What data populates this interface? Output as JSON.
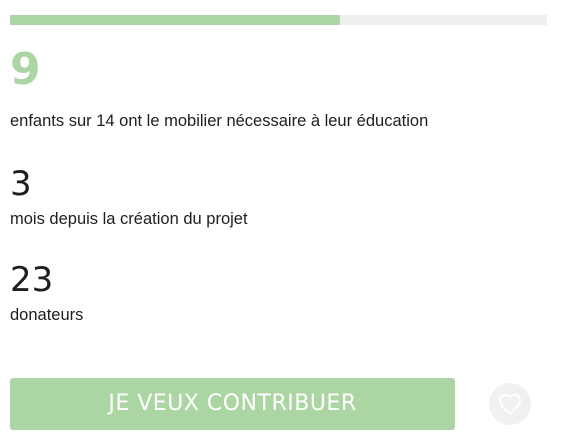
{
  "progress": {
    "fraction": 0.614,
    "fill_color": "#acd5a4",
    "track_color": "#efefef"
  },
  "highlight": {
    "number": "9",
    "caption": "enfants sur 14 ont le mobilier nécessaire à leur éducation",
    "color": "#acd5a4"
  },
  "stats": {
    "months": {
      "number": "3",
      "caption": "mois depuis la création du projet"
    },
    "donors": {
      "number": "23",
      "caption": "donateurs"
    }
  },
  "actions": {
    "contribute_label": "JE VEUX CONTRIBUER",
    "favorite_icon": "heart-icon"
  },
  "colors": {
    "accent": "#acd5a4",
    "text": "#1e1e1e"
  }
}
